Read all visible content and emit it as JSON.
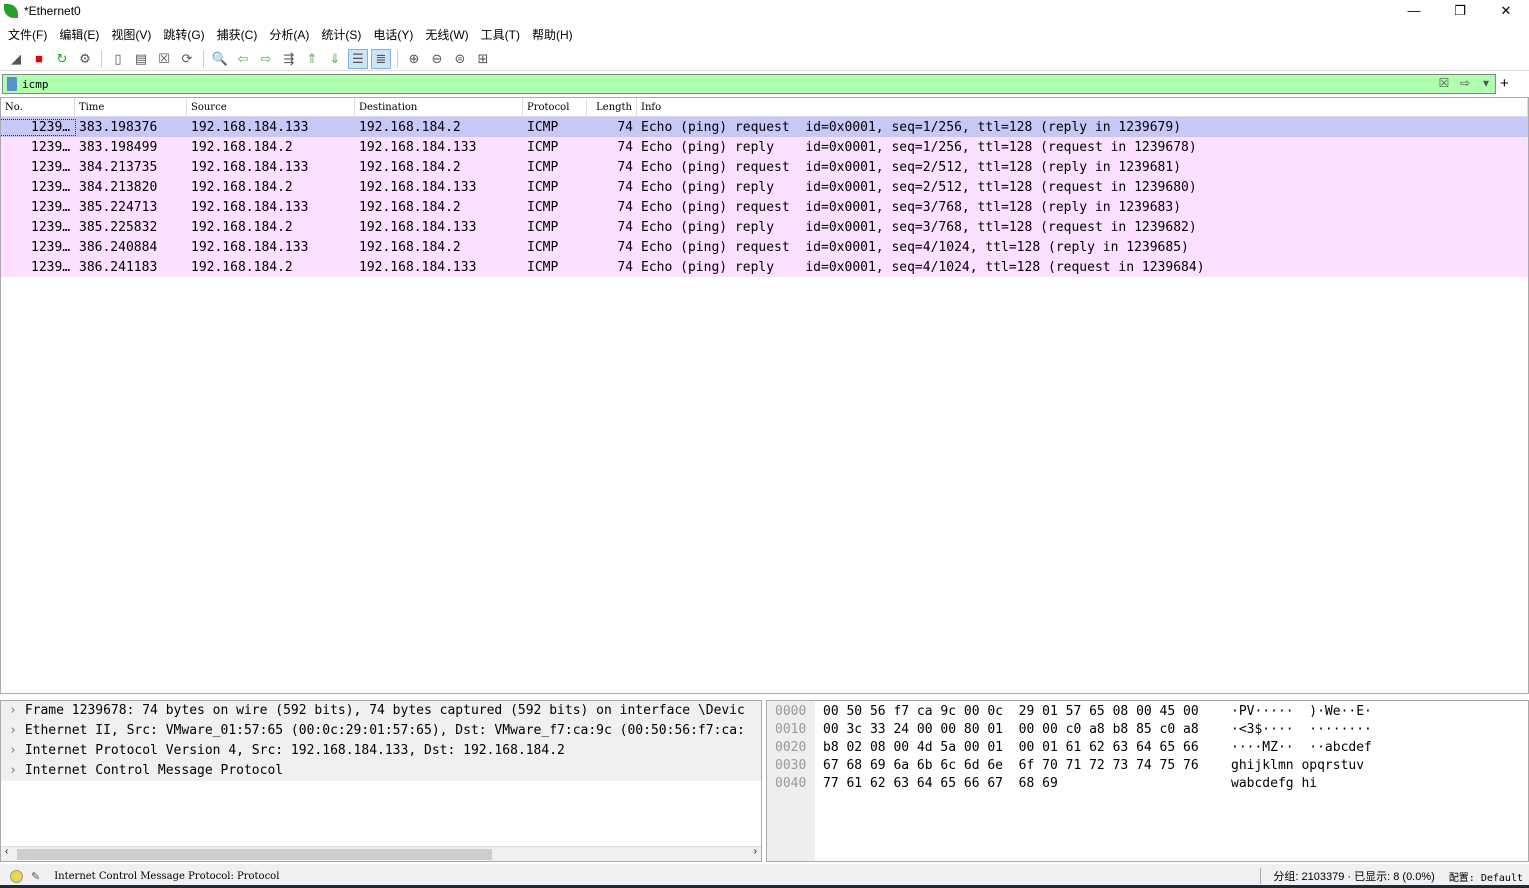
{
  "window": {
    "title": "*Ethernet0",
    "minimize": "—",
    "restore": "❐",
    "close": "✕"
  },
  "menu": [
    "文件(F)",
    "编辑(E)",
    "视图(V)",
    "跳转(G)",
    "捕获(C)",
    "分析(A)",
    "统计(S)",
    "电话(Y)",
    "无线(W)",
    "工具(T)",
    "帮助(H)"
  ],
  "toolbar": {
    "icons": [
      "shark-fin-start-icon",
      "stop-capture-icon",
      "restart-capture-icon",
      "capture-options-icon",
      "open-file-icon",
      "save-file-icon",
      "close-file-icon",
      "reload-file-icon",
      "find-packet-icon",
      "go-back-icon",
      "go-forward-icon",
      "go-to-packet-icon",
      "first-packet-icon",
      "last-packet-icon",
      "autoscroll-icon",
      "colorize-icon",
      "zoom-in-icon",
      "zoom-out-icon",
      "zoom-normal-icon",
      "resize-columns-icon"
    ],
    "active": [
      "autoscroll-icon",
      "colorize-icon"
    ]
  },
  "filter": {
    "value": "icmp",
    "add": "+"
  },
  "packet_list": {
    "columns": [
      "No.",
      "Time",
      "Source",
      "Destination",
      "Protocol",
      "Length",
      "Info"
    ],
    "rows": [
      [
        "1239…",
        "383.198376",
        "192.168.184.133",
        "192.168.184.2",
        "ICMP",
        "74",
        "Echo (ping) request  id=0x0001, seq=1/256, ttl=128 (reply in 1239679)"
      ],
      [
        "1239…",
        "383.198499",
        "192.168.184.2",
        "192.168.184.133",
        "ICMP",
        "74",
        "Echo (ping) reply    id=0x0001, seq=1/256, ttl=128 (request in 1239678)"
      ],
      [
        "1239…",
        "384.213735",
        "192.168.184.133",
        "192.168.184.2",
        "ICMP",
        "74",
        "Echo (ping) request  id=0x0001, seq=2/512, ttl=128 (reply in 1239681)"
      ],
      [
        "1239…",
        "384.213820",
        "192.168.184.2",
        "192.168.184.133",
        "ICMP",
        "74",
        "Echo (ping) reply    id=0x0001, seq=2/512, ttl=128 (request in 1239680)"
      ],
      [
        "1239…",
        "385.224713",
        "192.168.184.133",
        "192.168.184.2",
        "ICMP",
        "74",
        "Echo (ping) request  id=0x0001, seq=3/768, ttl=128 (reply in 1239683)"
      ],
      [
        "1239…",
        "385.225832",
        "192.168.184.2",
        "192.168.184.133",
        "ICMP",
        "74",
        "Echo (ping) reply    id=0x0001, seq=3/768, ttl=128 (request in 1239682)"
      ],
      [
        "1239…",
        "386.240884",
        "192.168.184.133",
        "192.168.184.2",
        "ICMP",
        "74",
        "Echo (ping) request  id=0x0001, seq=4/1024, ttl=128 (reply in 1239685)"
      ],
      [
        "1239…",
        "386.241183",
        "192.168.184.2",
        "192.168.184.133",
        "ICMP",
        "74",
        "Echo (ping) reply    id=0x0001, seq=4/1024, ttl=128 (request in 1239684)"
      ]
    ],
    "selected_row": 0,
    "colors": {
      "selected": "#c8c8f8",
      "icmp": "#fce0ff"
    }
  },
  "details": [
    "Frame 1239678: 74 bytes on wire (592 bits), 74 bytes captured (592 bits) on interface \\Devic",
    "Ethernet II, Src: VMware_01:57:65 (00:0c:29:01:57:65), Dst: VMware_f7:ca:9c (00:50:56:f7:ca:",
    "Internet Protocol Version 4, Src: 192.168.184.133, Dst: 192.168.184.2",
    "Internet Control Message Protocol"
  ],
  "bytes": [
    {
      "offset": "0000",
      "hex": "00 50 56 f7 ca 9c 00 0c  29 01 57 65 08 00 45 00",
      "ascii": "·PV·····  )·We··E·"
    },
    {
      "offset": "0010",
      "hex": "00 3c 33 24 00 00 80 01  00 00 c0 a8 b8 85 c0 a8",
      "ascii": "·<3$····  ········"
    },
    {
      "offset": "0020",
      "hex": "b8 02 08 00 4d 5a 00 01  00 01 61 62 63 64 65 66",
      "ascii": "····MZ··  ··abcdef"
    },
    {
      "offset": "0030",
      "hex": "67 68 69 6a 6b 6c 6d 6e  6f 70 71 72 73 74 75 76",
      "ascii": "ghijklmn opqrstuv"
    },
    {
      "offset": "0040",
      "hex": "77 61 62 63 64 65 66 67  68 69",
      "ascii": "wabcdefg hi"
    }
  ],
  "status": {
    "packet_info": "Internet Control Message Protocol: Protocol",
    "counts": "分组: 2103379 · 已显示: 8 (0.0%)",
    "profile": "配置: Default"
  }
}
